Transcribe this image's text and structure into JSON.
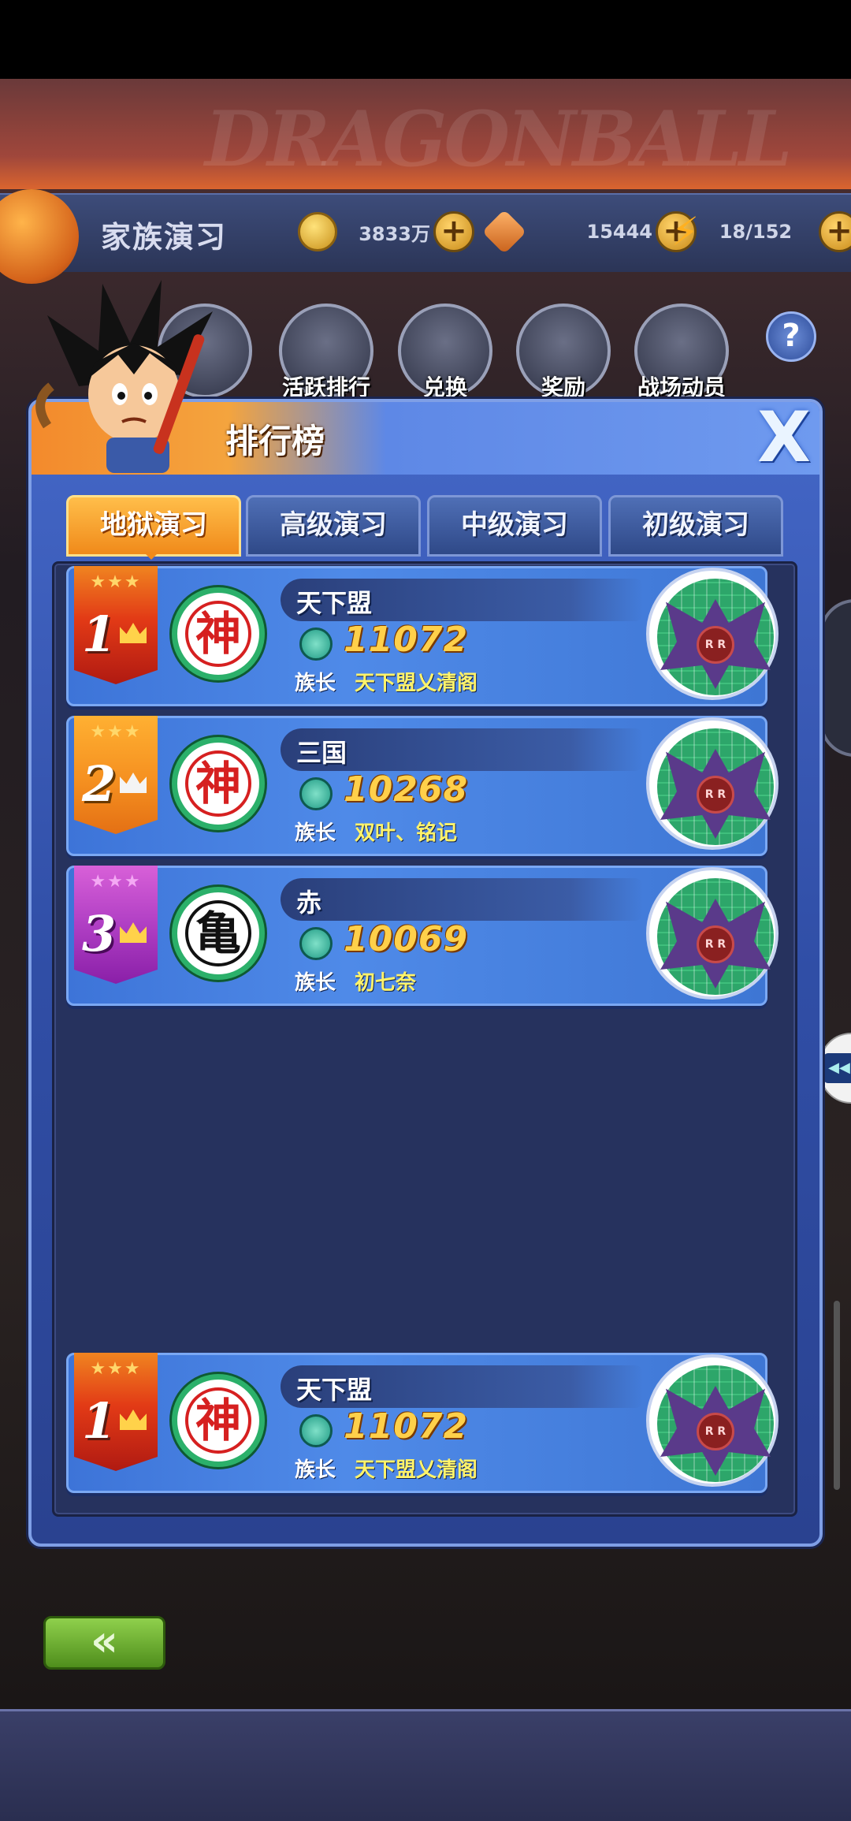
{
  "header": {
    "title": "家族演习",
    "gold": "3833万",
    "gems": "15444",
    "stamina": "18/152"
  },
  "menu": {
    "items": [
      {
        "label": "活跃排行",
        "icon": "trophy-icon"
      },
      {
        "label": "兑换",
        "icon": "scales-icon"
      },
      {
        "label": "奖励",
        "icon": "treasure-chest-icon"
      },
      {
        "label": "战场动员",
        "icon": "shield-7-icon"
      }
    ]
  },
  "modal": {
    "title": "排行榜",
    "close_symbol": "X"
  },
  "tabs": [
    {
      "label": "地狱演习",
      "active": true
    },
    {
      "label": "高级演习",
      "active": false
    },
    {
      "label": "中级演习",
      "active": false
    },
    {
      "label": "初级演习",
      "active": false
    }
  ],
  "rankings": [
    {
      "rank": "1",
      "badge": "神",
      "name": "天下盟",
      "score": "11072",
      "leader_label": "族长",
      "leader": "天下盟乂清阁"
    },
    {
      "rank": "2",
      "badge": "神",
      "name": "三国",
      "score": "10268",
      "leader_label": "族长",
      "leader": "双叶、铭记"
    },
    {
      "rank": "3",
      "badge": "亀",
      "name": "赤",
      "score": "10069",
      "leader_label": "族长",
      "leader": "初七奈"
    }
  ],
  "my_clan": {
    "rank": "1",
    "badge": "神",
    "name": "天下盟",
    "score": "11072",
    "leader_label": "族长",
    "leader": "天下盟乂清阁"
  },
  "stars": "★★★",
  "emblem_text": "R R",
  "back_symbol": "«",
  "colors": {
    "accent_orange": "#f08a1a",
    "panel_blue": "#304ea6",
    "score_gold": "#ffd04a"
  }
}
